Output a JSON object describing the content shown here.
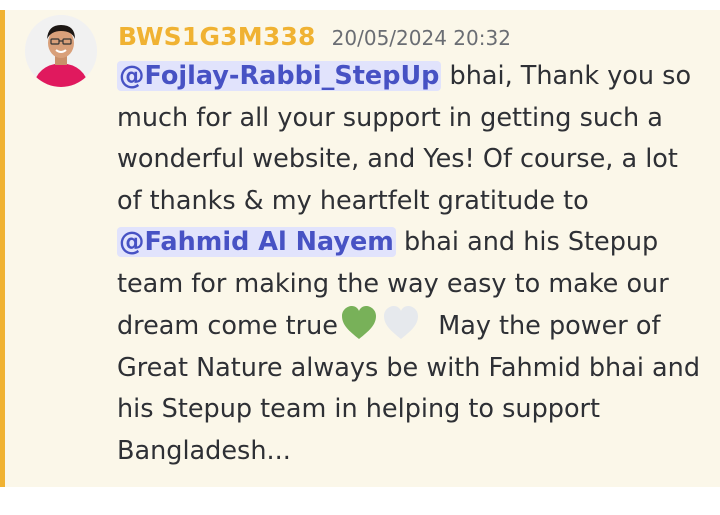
{
  "message": {
    "author": "BWS1G3M338",
    "timestamp": "20/05/2024 20:32",
    "avatar_icon": "user-avatar-photo",
    "accent_color": "#f0b232",
    "segments": {
      "mention1": "@Fojlay-Rabbi_StepUp",
      "text1": " bhai, Thank you so much for all your support in getting such a wonderful website, and Yes! Of course, a lot of thanks & my heartfelt gratitude to ",
      "mention2": "@Fahmid Al Nayem",
      "text2": " bhai and his Stepup team for making the way easy to make our dream come true",
      "emoji1": "green-heart-icon",
      "emoji2": "white-heart-icon",
      "text3": "May the power of Great Nature always be with Fahmid bhai and his Stepup team in helping to support Bangladesh..."
    }
  }
}
